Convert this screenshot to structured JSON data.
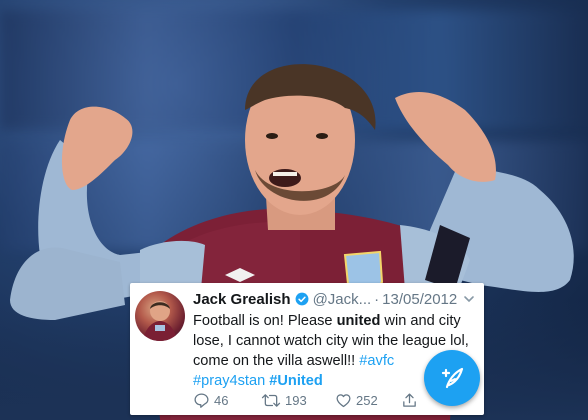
{
  "background": {
    "subject": "photo-background"
  },
  "tweet": {
    "display_name": "Jack Grealish",
    "handle": "@Jack...",
    "separator": "·",
    "date": "13/05/2012",
    "text_part1": "Football is on! Please ",
    "text_bold": "united",
    "text_part2": " win and city lose, I cannot watch city win the league lol, come on the villa aswell!! ",
    "hashtag1": "#avfc",
    "hashtag2": "#pray4stan",
    "hashtag3": "#United",
    "replies": "46",
    "retweets": "193",
    "likes": "252",
    "accent_color": "#1da1f2"
  },
  "icons": {
    "verified": "verified-badge-icon",
    "chevron": "chevron-down-icon",
    "reply": "reply-icon",
    "retweet": "retweet-icon",
    "like": "heart-icon",
    "share": "share-icon",
    "compose": "compose-tweet-icon"
  }
}
